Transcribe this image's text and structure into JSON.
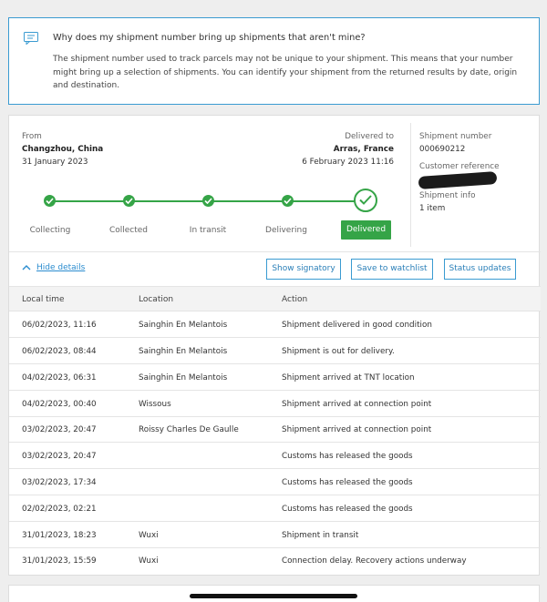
{
  "notice": {
    "icon": "chat-icon",
    "question": "Why does my shipment number bring up shipments that aren't mine?",
    "answer": "The shipment number used to track parcels may not be unique to your shipment. This means that your number might bring up a selection of shipments. You can identify your shipment from the returned results by date, origin and destination."
  },
  "shipment": {
    "from_label": "From",
    "from_place": "Changzhou, China",
    "from_date": "31 January 2023",
    "to_label": "Delivered to",
    "to_place": "Arras, France",
    "to_date": "6 February 2023 11:16",
    "number_label": "Shipment number",
    "number": "000690212",
    "reference_label": "Customer reference",
    "info_label": "Shipment info",
    "info": "1 item",
    "stages": [
      "Collecting",
      "Collected",
      "In transit",
      "Delivering",
      "Delivered"
    ],
    "active_stage": "Delivered",
    "accent": "#35a447"
  },
  "actions": {
    "hide_details": "Hide details",
    "show_signatory": "Show signatory",
    "save_watchlist": "Save to watchlist",
    "status_updates": "Status updates"
  },
  "table": {
    "headers": [
      "Local time",
      "Location",
      "Action"
    ],
    "rows": [
      [
        "06/02/2023, 11:16",
        "Sainghin En Melantois",
        "Shipment delivered in good condition"
      ],
      [
        "06/02/2023, 08:44",
        "Sainghin En Melantois",
        "Shipment is out for delivery."
      ],
      [
        "04/02/2023, 06:31",
        "Sainghin En Melantois",
        "Shipment arrived at TNT location"
      ],
      [
        "04/02/2023, 00:40",
        "Wissous",
        "Shipment arrived at connection point"
      ],
      [
        "03/02/2023, 20:47",
        "Roissy Charles De Gaulle",
        "Shipment arrived at connection point"
      ],
      [
        "03/02/2023, 20:47",
        "",
        "Customs has released the goods"
      ],
      [
        "03/02/2023, 17:34",
        "",
        "Customs has released the goods"
      ],
      [
        "02/02/2023, 02:21",
        "",
        "Customs has released the goods"
      ],
      [
        "31/01/2023, 18:23",
        "Wuxi",
        "Shipment in transit"
      ],
      [
        "31/01/2023, 15:59",
        "Wuxi",
        "Connection delay. Recovery actions underway"
      ]
    ]
  }
}
